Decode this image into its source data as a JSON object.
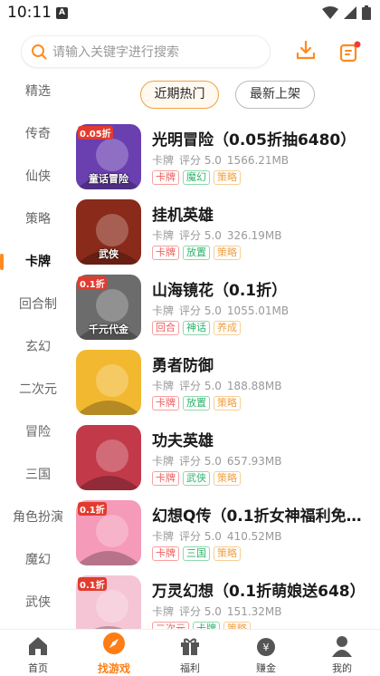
{
  "status": {
    "time": "10:11"
  },
  "search": {
    "placeholder": "请输入关键字进行搜索"
  },
  "sidebar": {
    "items": [
      {
        "label": "精选",
        "active": false
      },
      {
        "label": "传奇",
        "active": false
      },
      {
        "label": "仙侠",
        "active": false
      },
      {
        "label": "策略",
        "active": false
      },
      {
        "label": "卡牌",
        "active": true
      },
      {
        "label": "回合制",
        "active": false
      },
      {
        "label": "玄幻",
        "active": false
      },
      {
        "label": "二次元",
        "active": false
      },
      {
        "label": "冒险",
        "active": false
      },
      {
        "label": "三国",
        "active": false
      },
      {
        "label": "角色扮演",
        "active": false
      },
      {
        "label": "魔幻",
        "active": false
      },
      {
        "label": "武侠",
        "active": false
      }
    ]
  },
  "tabs": {
    "hot": "近期热门",
    "new": "最新上架"
  },
  "games": [
    {
      "name": "光明冒险（0.05折抽6480）",
      "category": "卡牌",
      "score": "评分 5.0",
      "size": "1566.21MB",
      "tags": [
        {
          "t": "卡牌",
          "c": "red"
        },
        {
          "t": "魔幻",
          "c": "green"
        },
        {
          "t": "策略",
          "c": "orange"
        }
      ],
      "badge": "0.05折",
      "cover_text": "童话冒险",
      "cover_color": "#6a3fb0"
    },
    {
      "name": "挂机英雄",
      "category": "卡牌",
      "score": "评分 5.0",
      "size": "326.19MB",
      "tags": [
        {
          "t": "卡牌",
          "c": "red"
        },
        {
          "t": "放置",
          "c": "green"
        },
        {
          "t": "策略",
          "c": "orange"
        }
      ],
      "badge": "",
      "cover_text": "武侠",
      "cover_color": "#8a2a1a"
    },
    {
      "name": "山海镜花（0.1折）",
      "category": "卡牌",
      "score": "评分 5.0",
      "size": "1055.01MB",
      "tags": [
        {
          "t": "回合",
          "c": "red"
        },
        {
          "t": "神话",
          "c": "green"
        },
        {
          "t": "养成",
          "c": "orange"
        }
      ],
      "badge": "0.1折",
      "cover_text": "千元代金",
      "cover_color": "#6c6c6c"
    },
    {
      "name": "勇者防御",
      "category": "卡牌",
      "score": "评分 5.0",
      "size": "188.88MB",
      "tags": [
        {
          "t": "卡牌",
          "c": "red"
        },
        {
          "t": "放置",
          "c": "green"
        },
        {
          "t": "策略",
          "c": "orange"
        }
      ],
      "badge": "",
      "cover_text": "",
      "cover_color": "#f2b830"
    },
    {
      "name": "功夫英雄",
      "category": "卡牌",
      "score": "评分 5.0",
      "size": "657.93MB",
      "tags": [
        {
          "t": "卡牌",
          "c": "red"
        },
        {
          "t": "武侠",
          "c": "green"
        },
        {
          "t": "策略",
          "c": "orange"
        }
      ],
      "badge": "",
      "cover_text": "",
      "cover_color": "#c23a4a"
    },
    {
      "name": "幻想Q传（0.1折女神福利免充…",
      "category": "卡牌",
      "score": "评分 5.0",
      "size": "410.52MB",
      "tags": [
        {
          "t": "卡牌",
          "c": "red"
        },
        {
          "t": "三国",
          "c": "green"
        },
        {
          "t": "策略",
          "c": "orange"
        }
      ],
      "badge": "0.1折",
      "cover_text": "",
      "cover_color": "#f59ab8"
    },
    {
      "name": "万灵幻想（0.1折萌娘送648）",
      "category": "卡牌",
      "score": "评分 5.0",
      "size": "151.32MB",
      "tags": [
        {
          "t": "二次元",
          "c": "red"
        },
        {
          "t": "卡牌",
          "c": "green"
        },
        {
          "t": "策略",
          "c": "orange"
        }
      ],
      "badge": "0.1折",
      "cover_text": "",
      "cover_color": "#f5c5d5"
    }
  ],
  "nav": [
    {
      "label": "首页",
      "icon": "home-icon",
      "active": false
    },
    {
      "label": "找游戏",
      "icon": "compass-icon",
      "active": true
    },
    {
      "label": "福利",
      "icon": "gift-icon",
      "active": false
    },
    {
      "label": "赚金",
      "icon": "money-bag-icon",
      "active": false
    },
    {
      "label": "我的",
      "icon": "profile-icon",
      "active": false
    }
  ],
  "colors": {
    "accent": "#ff7d14",
    "tag_red": "#ef5b5b",
    "tag_green": "#2db36b",
    "tag_orange": "#f0a040"
  }
}
